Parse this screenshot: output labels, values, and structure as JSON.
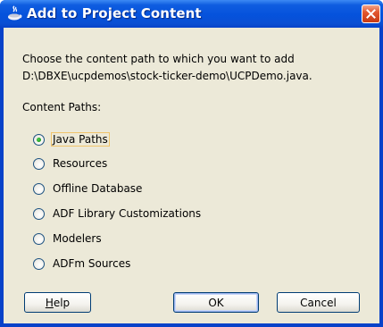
{
  "window": {
    "title": "Add to Project Content",
    "icon": "coffee-cup-icon",
    "close_icon": "close-icon"
  },
  "description": {
    "line1": "Choose the content path to which you want to add",
    "line2": "D:\\DBXE\\ucpdemos\\stock-ticker-demo\\UCPDemo.java."
  },
  "content_paths": {
    "label": "Content Paths:",
    "selected": "Java Paths",
    "options": [
      {
        "label": "Java Paths",
        "checked": true
      },
      {
        "label": "Resources",
        "checked": false
      },
      {
        "label": "Offline Database",
        "checked": false
      },
      {
        "label": "ADF Library Customizations",
        "checked": false
      },
      {
        "label": "Modelers",
        "checked": false
      },
      {
        "label": "ADFm Sources",
        "checked": false
      }
    ]
  },
  "buttons": {
    "help_first": "H",
    "help_rest": "elp",
    "ok": "OK",
    "cancel": "Cancel"
  },
  "colors": {
    "titlebar": "#0552dc",
    "dialog_bg": "#ece9d8",
    "close_button": "#e2562f",
    "focus_border": "#f0c46a"
  }
}
